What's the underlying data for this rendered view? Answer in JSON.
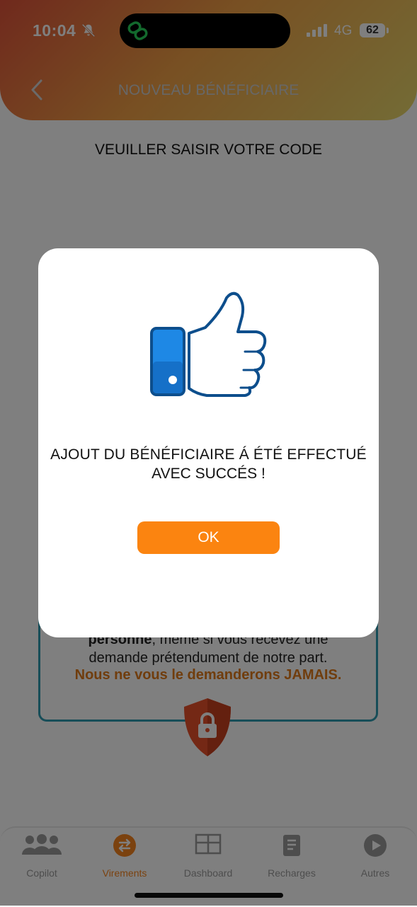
{
  "status_bar": {
    "time": "10:04",
    "network": "4G",
    "battery": "62"
  },
  "header": {
    "title": "NOUVEAU BÉNÉFICIAIRE"
  },
  "prompt": "VEUILLER SAISIR VOTRE CODE",
  "warning": {
    "line1_bold": "personne",
    "line1_rest": ", même si vous recevez une",
    "line2": "demande prétendument de notre part.",
    "line3": "Nous ne vous le demanderons JAMAIS."
  },
  "modal": {
    "message_line1": "AJOUT DU BÉNÉFICIAIRE Á ÉTÉ EFFECTUÉ",
    "message_line2": "AVEC SUCCÉS !",
    "ok_label": "OK"
  },
  "tabs": [
    {
      "label": "Copilot",
      "icon": "people-icon",
      "active": false
    },
    {
      "label": "Virements",
      "icon": "transfer-icon",
      "active": true
    },
    {
      "label": "Dashboard",
      "icon": "dashboard-icon",
      "active": false
    },
    {
      "label": "Recharges",
      "icon": "document-icon",
      "active": false
    },
    {
      "label": "Autres",
      "icon": "play-icon",
      "active": false
    }
  ],
  "colors": {
    "accent": "#fb8410",
    "card_border": "#2e9bb1",
    "thumb_blue": "#0d4e8c"
  }
}
